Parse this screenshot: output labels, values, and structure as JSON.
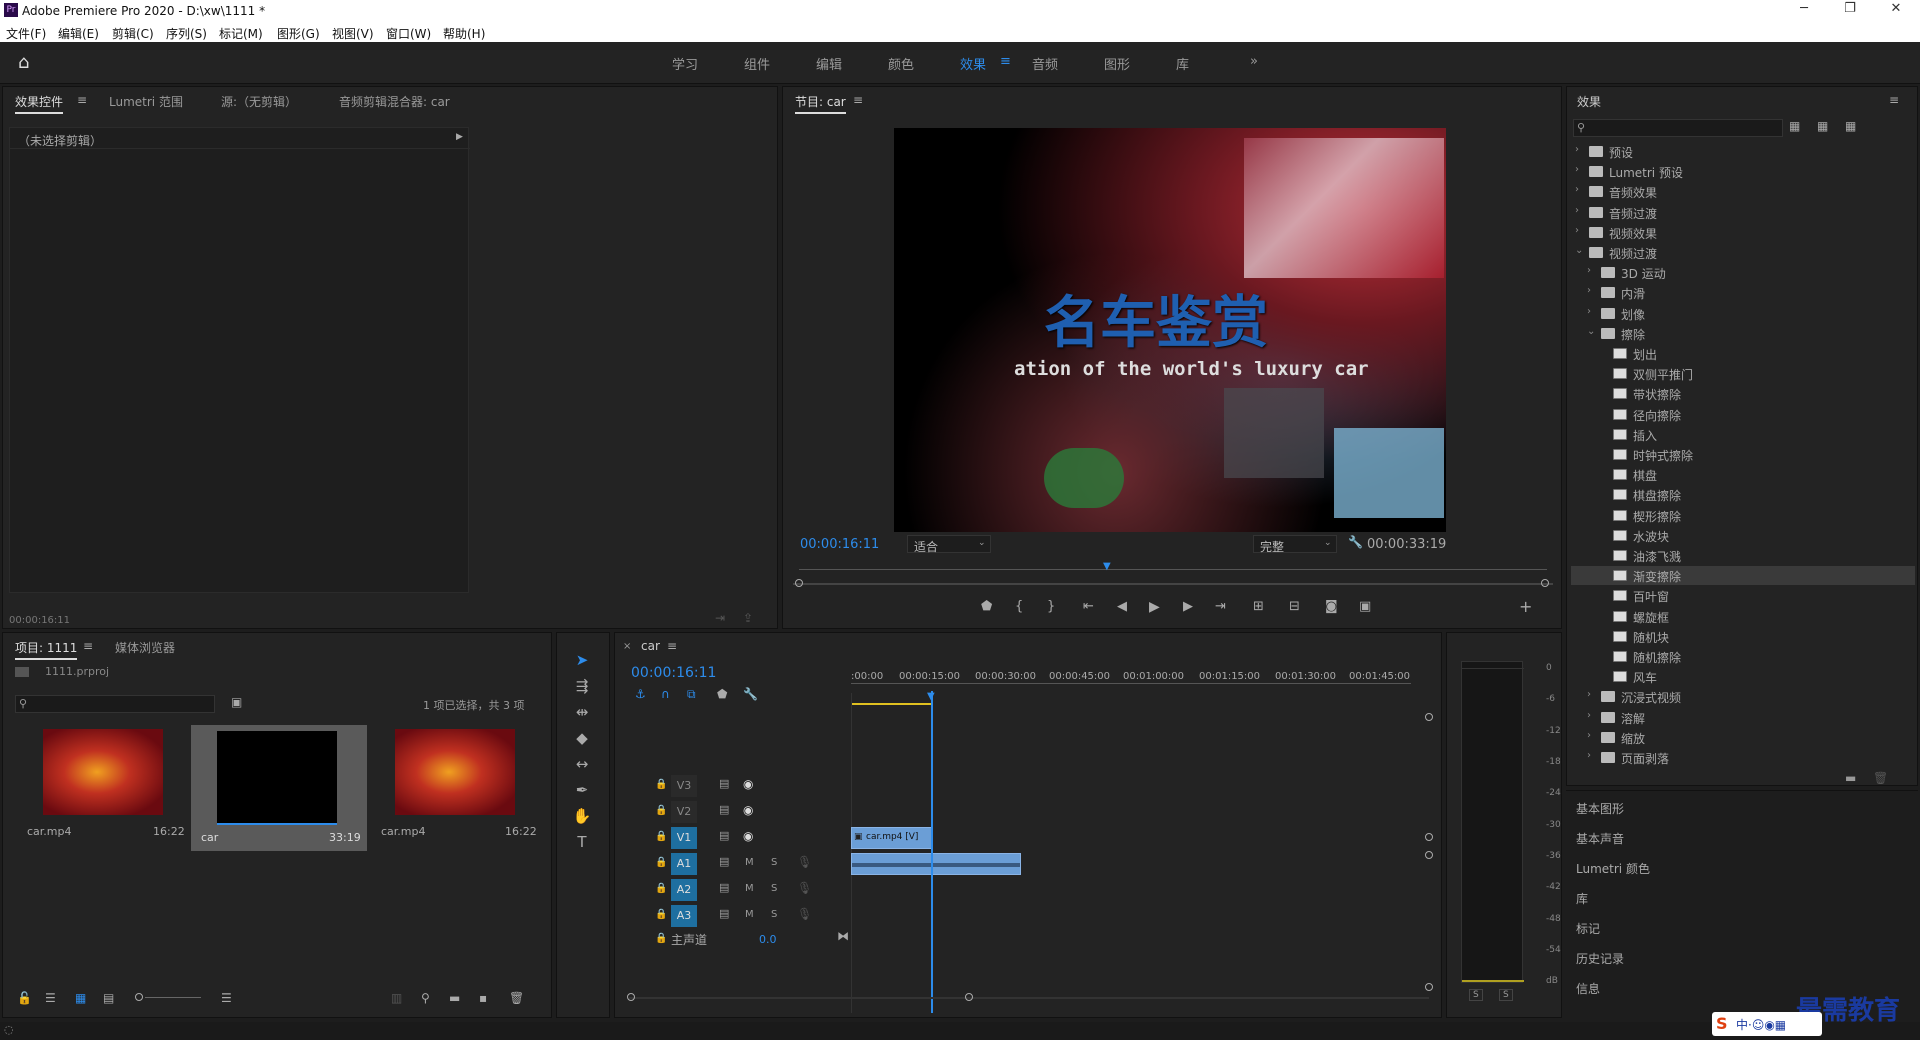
{
  "app": {
    "title": "Adobe Premiere Pro 2020 - D:\\xw\\1111 *"
  },
  "menu": [
    "文件(F)",
    "编辑(E)",
    "剪辑(C)",
    "序列(S)",
    "标记(M)",
    "图形(G)",
    "视图(V)",
    "窗口(W)",
    "帮助(H)"
  ],
  "workspaces": [
    "学习",
    "组件",
    "编辑",
    "颜色",
    "效果",
    "音频",
    "图形",
    "库"
  ],
  "active_workspace": "效果",
  "source_panel": {
    "tabs": [
      "效果控件",
      "Lumetri 范围",
      "源:（无剪辑）",
      "音频剪辑混合器: car"
    ],
    "no_clip": "（未选择剪辑）",
    "timecode": "00:00:16:11"
  },
  "program": {
    "title": "节目: car",
    "overlay_title": "名车鉴赏",
    "overlay_subtitle": "ation of the world's luxury car",
    "timecode": "00:00:16:11",
    "fit": "适合",
    "quality": "完整",
    "duration": "00:00:33:19"
  },
  "effects": {
    "title": "效果",
    "items": [
      {
        "label": "预设",
        "level": 0,
        "type": "folder",
        "expanded": false
      },
      {
        "label": "Lumetri 预设",
        "level": 0,
        "type": "folder",
        "expanded": false
      },
      {
        "label": "音频效果",
        "level": 0,
        "type": "folder",
        "expanded": false
      },
      {
        "label": "音频过渡",
        "level": 0,
        "type": "folder",
        "expanded": false
      },
      {
        "label": "视频效果",
        "level": 0,
        "type": "folder",
        "expanded": false
      },
      {
        "label": "视频过渡",
        "level": 0,
        "type": "folder",
        "expanded": true
      },
      {
        "label": "3D 运动",
        "level": 1,
        "type": "folder",
        "expanded": false
      },
      {
        "label": "内滑",
        "level": 1,
        "type": "folder",
        "expanded": false
      },
      {
        "label": "划像",
        "level": 1,
        "type": "folder",
        "expanded": false
      },
      {
        "label": "擦除",
        "level": 1,
        "type": "folder",
        "expanded": true
      },
      {
        "label": "划出",
        "level": 2,
        "type": "fx"
      },
      {
        "label": "双侧平推门",
        "level": 2,
        "type": "fx"
      },
      {
        "label": "带状擦除",
        "level": 2,
        "type": "fx"
      },
      {
        "label": "径向擦除",
        "level": 2,
        "type": "fx"
      },
      {
        "label": "插入",
        "level": 2,
        "type": "fx"
      },
      {
        "label": "时钟式擦除",
        "level": 2,
        "type": "fx"
      },
      {
        "label": "棋盘",
        "level": 2,
        "type": "fx"
      },
      {
        "label": "棋盘擦除",
        "level": 2,
        "type": "fx"
      },
      {
        "label": "楔形擦除",
        "level": 2,
        "type": "fx"
      },
      {
        "label": "水波块",
        "level": 2,
        "type": "fx"
      },
      {
        "label": "油漆飞溅",
        "level": 2,
        "type": "fx"
      },
      {
        "label": "渐变擦除",
        "level": 2,
        "type": "fx",
        "selected": true
      },
      {
        "label": "百叶窗",
        "level": 2,
        "type": "fx"
      },
      {
        "label": "螺旋框",
        "level": 2,
        "type": "fx"
      },
      {
        "label": "随机块",
        "level": 2,
        "type": "fx"
      },
      {
        "label": "随机擦除",
        "level": 2,
        "type": "fx"
      },
      {
        "label": "风车",
        "level": 2,
        "type": "fx"
      },
      {
        "label": "沉浸式视频",
        "level": 1,
        "type": "folder",
        "expanded": false
      },
      {
        "label": "溶解",
        "level": 1,
        "type": "folder",
        "expanded": false
      },
      {
        "label": "缩放",
        "level": 1,
        "type": "folder",
        "expanded": false
      },
      {
        "label": "页面剥落",
        "level": 1,
        "type": "folder",
        "expanded": false
      }
    ],
    "panels": [
      "基本图形",
      "基本声音",
      "Lumetri 颜色",
      "库",
      "标记",
      "历史记录",
      "信息"
    ]
  },
  "project": {
    "tabs": [
      "项目: 1111",
      "媒体浏览器"
    ],
    "file": "1111.prproj",
    "selection": "1 项已选择，共 3 项",
    "items": [
      {
        "name": "car.mp4",
        "duration": "16:22"
      },
      {
        "name": "car",
        "duration": "33:19"
      },
      {
        "name": "car.mp4",
        "duration": "16:22"
      }
    ]
  },
  "timeline": {
    "tab": "car",
    "timecode": "00:00:16:11",
    "ruler": [
      ":00:00",
      "00:00:15:00",
      "00:00:30:00",
      "00:00:45:00",
      "00:01:00:00",
      "00:01:15:00",
      "00:01:30:00",
      "00:01:45:00"
    ],
    "video_tracks": [
      "V3",
      "V2",
      "V1"
    ],
    "audio_tracks": [
      "A1",
      "A2",
      "A3"
    ],
    "master": "主声道",
    "master_value": "0.0",
    "clip_label": "car.mp4 [V]",
    "m": "M",
    "s": "S"
  },
  "meter": {
    "ticks": [
      "0",
      "-6",
      "-12",
      "-18",
      "-24",
      "-30",
      "-36",
      "-42",
      "-48",
      "-54",
      "dB"
    ],
    "solo": [
      "S",
      "S"
    ]
  },
  "watermark": "最需教育",
  "colors": {
    "accent": "#2d8ceb",
    "clip": "#6b9ed6",
    "playhead": "#2d8ceb"
  }
}
